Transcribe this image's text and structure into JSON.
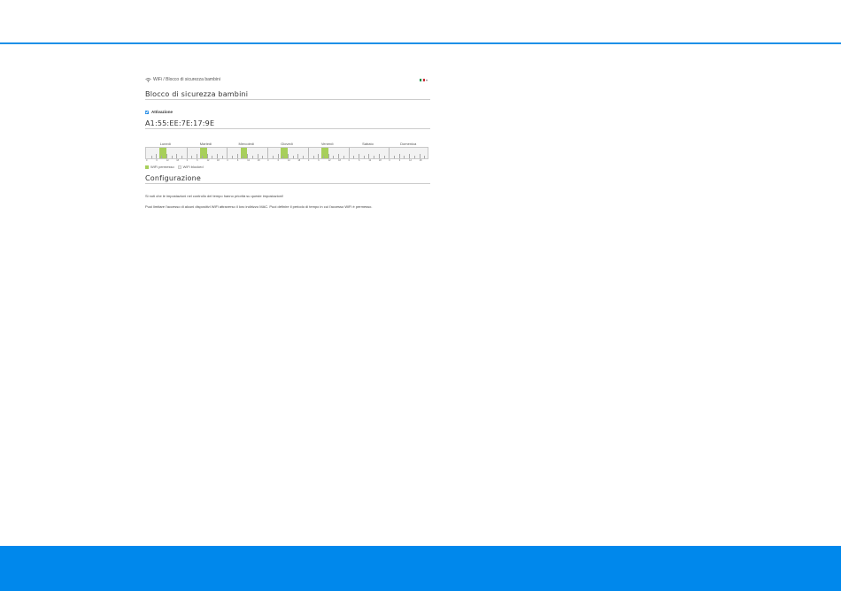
{
  "breadcrumb": {
    "icon": "wifi-icon",
    "text": "WiFi / Blocco di sicurezza bambini"
  },
  "language": {
    "icon": "italian-flag-icon",
    "colors": [
      "#009246",
      "#ffffff",
      "#ce2b37"
    ]
  },
  "section_title": "Blocco di sicurezza bambini",
  "activation": {
    "label": "Attivazione",
    "checked": true
  },
  "device_mac": "A1:55:EE:7E:17:9E",
  "schedule": {
    "days": [
      "Lunedì",
      "Martedì",
      "Mercoledì",
      "Giovedì",
      "Venerdì",
      "Sabato",
      "Domenica"
    ],
    "hour_ticks": [
      "0",
      "6",
      "12",
      "18"
    ],
    "allowed_windows": [
      {
        "day": "Lunedì",
        "from": 8,
        "to": 12
      },
      {
        "day": "Martedì",
        "from": 8,
        "to": 12
      },
      {
        "day": "Mercoledì",
        "from": 8,
        "to": 12
      },
      {
        "day": "Giovedì",
        "from": 8,
        "to": 12
      },
      {
        "day": "Venerdì",
        "from": 8,
        "to": 12
      }
    ],
    "colors": {
      "allowed": "#a7cf5a",
      "blocked": "#f2f2f2"
    },
    "legend": {
      "allowed": "WiFi permesso",
      "blocked": "WiFi blocked"
    }
  },
  "config": {
    "title": "Configurazione",
    "note1": "Si noti che le impostazioni nel controllo del tempo hanno priorità su queste impostazioni!",
    "note2": "Puoi limitare l'accesso di alcuni dispositivi WiFi attraverso il loro indirizzo MAC. Puoi definire il periodo di tempo in cui l'accesso WiFi è permesso."
  },
  "theme": {
    "accent": "#1e90e8",
    "footer": "#0088ec"
  }
}
